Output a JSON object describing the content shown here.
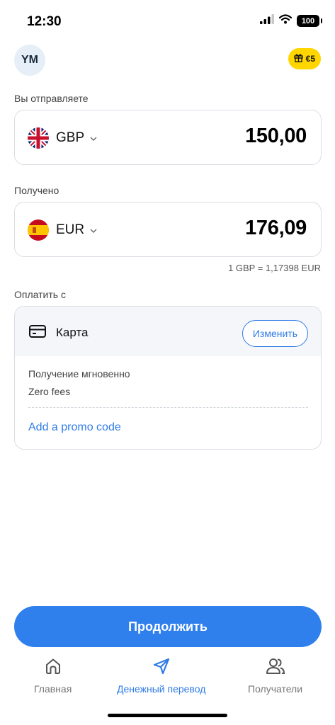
{
  "status_bar": {
    "time": "12:30",
    "battery": "100"
  },
  "header": {
    "avatar_initials": "YM",
    "gift_badge": "€5"
  },
  "send": {
    "label": "Вы отправляете",
    "currency": "GBP",
    "amount": "150,00",
    "flag_icon": "uk-flag-icon"
  },
  "receive": {
    "label": "Получено",
    "currency": "EUR",
    "amount": "176,09",
    "flag_icon": "spain-flag-icon"
  },
  "exchange_rate": "1 GBP = 1,17398 EUR",
  "payment": {
    "label": "Оплатить с",
    "method": "Карта",
    "change_label": "Изменить",
    "delivery": "Получение мгновенно",
    "fees": "Zero fees",
    "promo_link": "Add a promo code"
  },
  "continue_label": "Продолжить",
  "nav": {
    "items": [
      {
        "label": "Главная",
        "icon": "home-icon",
        "active": false
      },
      {
        "label": "Денежный перевод",
        "icon": "send-icon",
        "active": true
      },
      {
        "label": "Получатели",
        "icon": "recipients-icon",
        "active": false
      }
    ]
  },
  "colors": {
    "accent": "#2f7be6",
    "badge": "#ffd600",
    "button": "#2f80ed"
  }
}
